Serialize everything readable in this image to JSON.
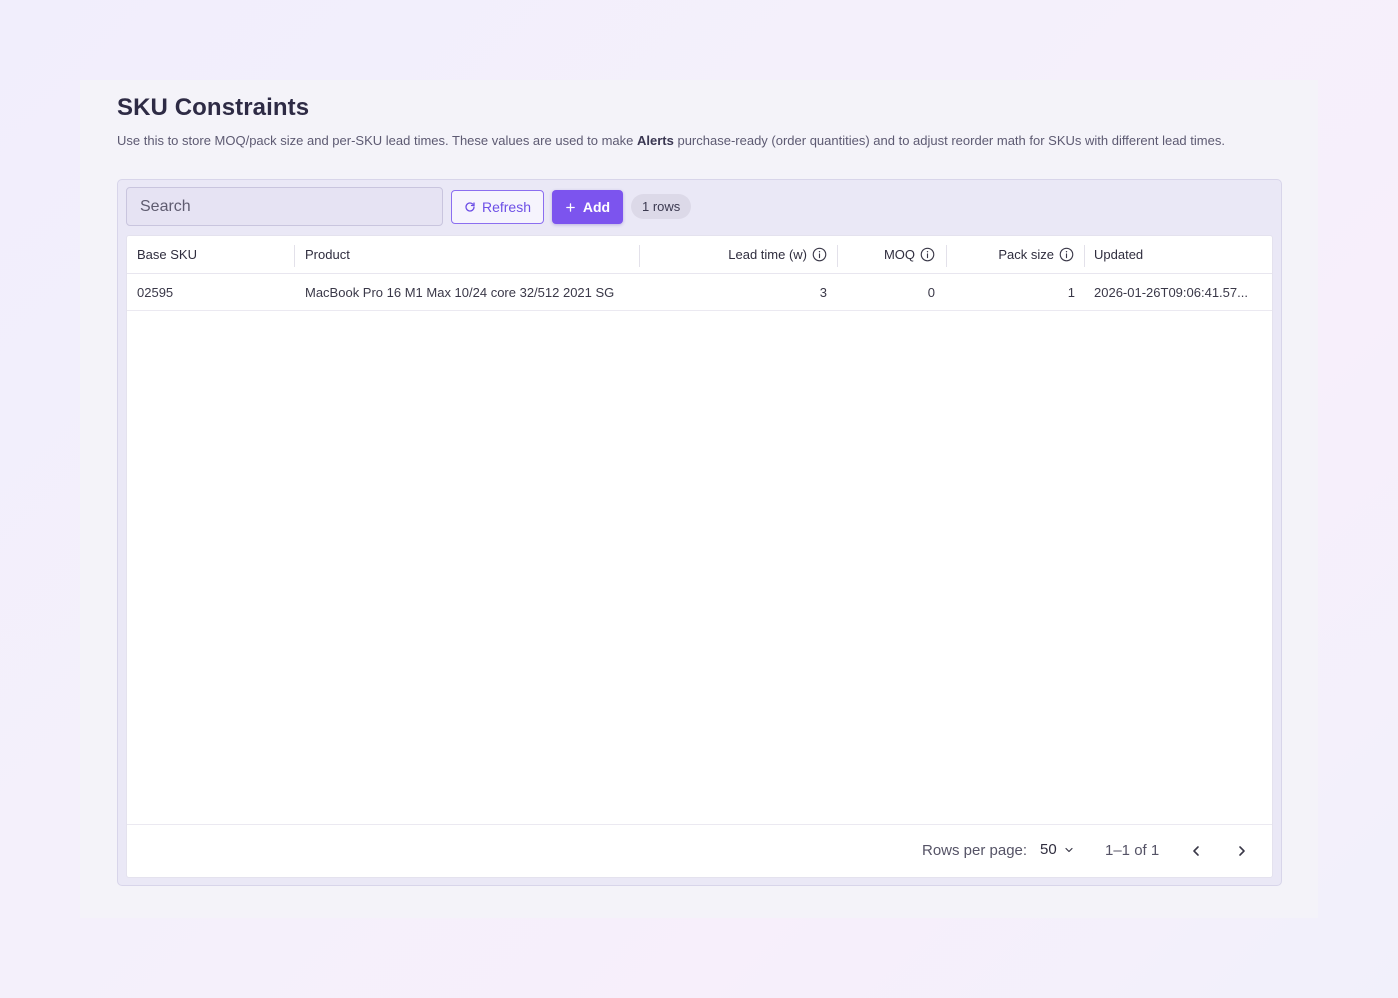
{
  "page": {
    "title": "SKU Constraints",
    "description_pre": "Use this to store MOQ/pack size and per-SKU lead times. These values are used to make ",
    "description_bold": "Alerts",
    "description_post": " purchase-ready (order quantities) and to adjust reorder math for SKUs with different lead times."
  },
  "toolbar": {
    "search_placeholder": "Search",
    "refresh_label": "Refresh",
    "add_label": "Add",
    "rows_badge": "1 rows"
  },
  "table": {
    "columns": [
      "Base SKU",
      "Product",
      "Lead time (w)",
      "MOQ",
      "Pack size",
      "Updated"
    ],
    "rows": [
      {
        "base_sku": "02595",
        "product": "MacBook Pro 16 M1 Max 10/24 core 32/512 2021 SG",
        "lead_time": "3",
        "moq": "0",
        "pack_size": "1",
        "updated": "2026-01-26T09:06:41.57..."
      }
    ]
  },
  "pagination": {
    "rows_per_page_label": "Rows per page:",
    "rows_per_page_value": "50",
    "range_label": "1–1 of 1"
  },
  "colors": {
    "accent": "#7c54ee",
    "title": "#2e2b45"
  },
  "icons": {
    "refresh": "refresh-icon",
    "add": "plus-icon",
    "info": "info-icon",
    "dropdown": "chevron-down-icon",
    "prev": "chevron-left-icon",
    "next": "chevron-right-icon"
  }
}
